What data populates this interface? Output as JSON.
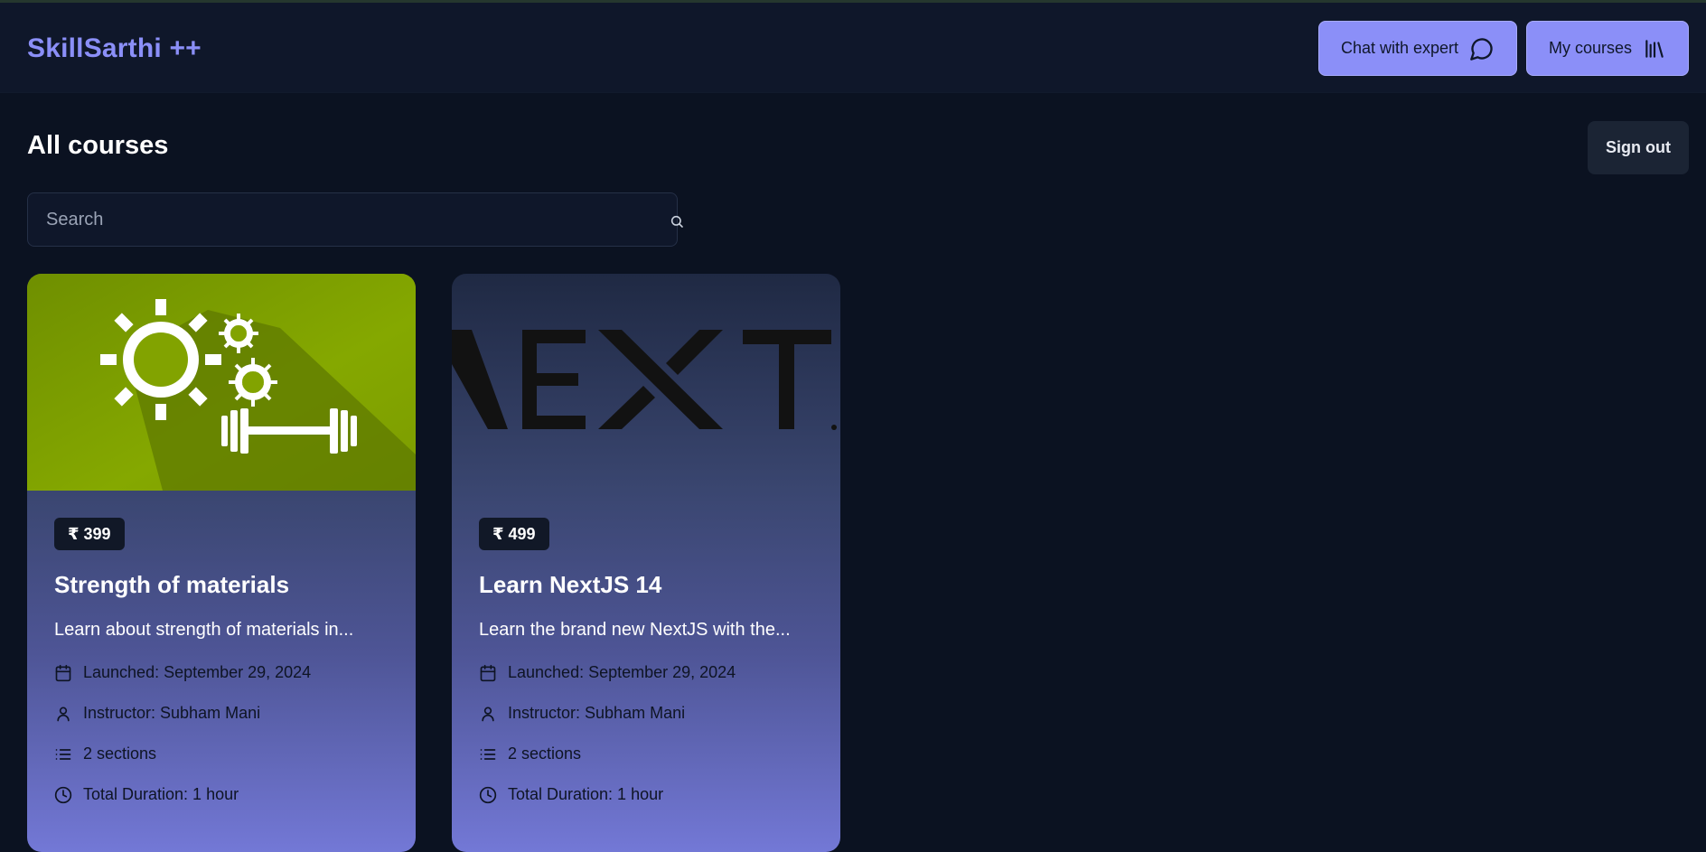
{
  "header": {
    "brand": "SkillSarthi ++",
    "chat_label": "Chat with expert",
    "chat_icon": "chat-bubble-icon",
    "my_courses_label": "My courses",
    "my_courses_icon": "library-icon",
    "accent_color": "#8b8ff8"
  },
  "main": {
    "title": "All courses",
    "sign_out_label": "Sign out",
    "search": {
      "placeholder": "Search",
      "value": "",
      "icon": "search-icon"
    },
    "courses": [
      {
        "price": "₹ 399",
        "title": "Strength of materials",
        "description": "Learn about strength of materials in...",
        "launched": "Launched: September 29, 2024",
        "instructor": "Instructor: Subham Mani",
        "sections": "2 sections",
        "duration": "Total Duration: 1 hour",
        "thumbnail": "gears-and-dumbbell-image"
      },
      {
        "price": "₹ 499",
        "title": "Learn NextJS 14",
        "description": "Learn the brand new NextJS with the...",
        "launched": "Launched: September 29, 2024",
        "instructor": "Instructor: Subham Mani",
        "sections": "2 sections",
        "duration": "Total Duration: 1 hour",
        "thumbnail": "nextjs-logo-image"
      }
    ]
  }
}
